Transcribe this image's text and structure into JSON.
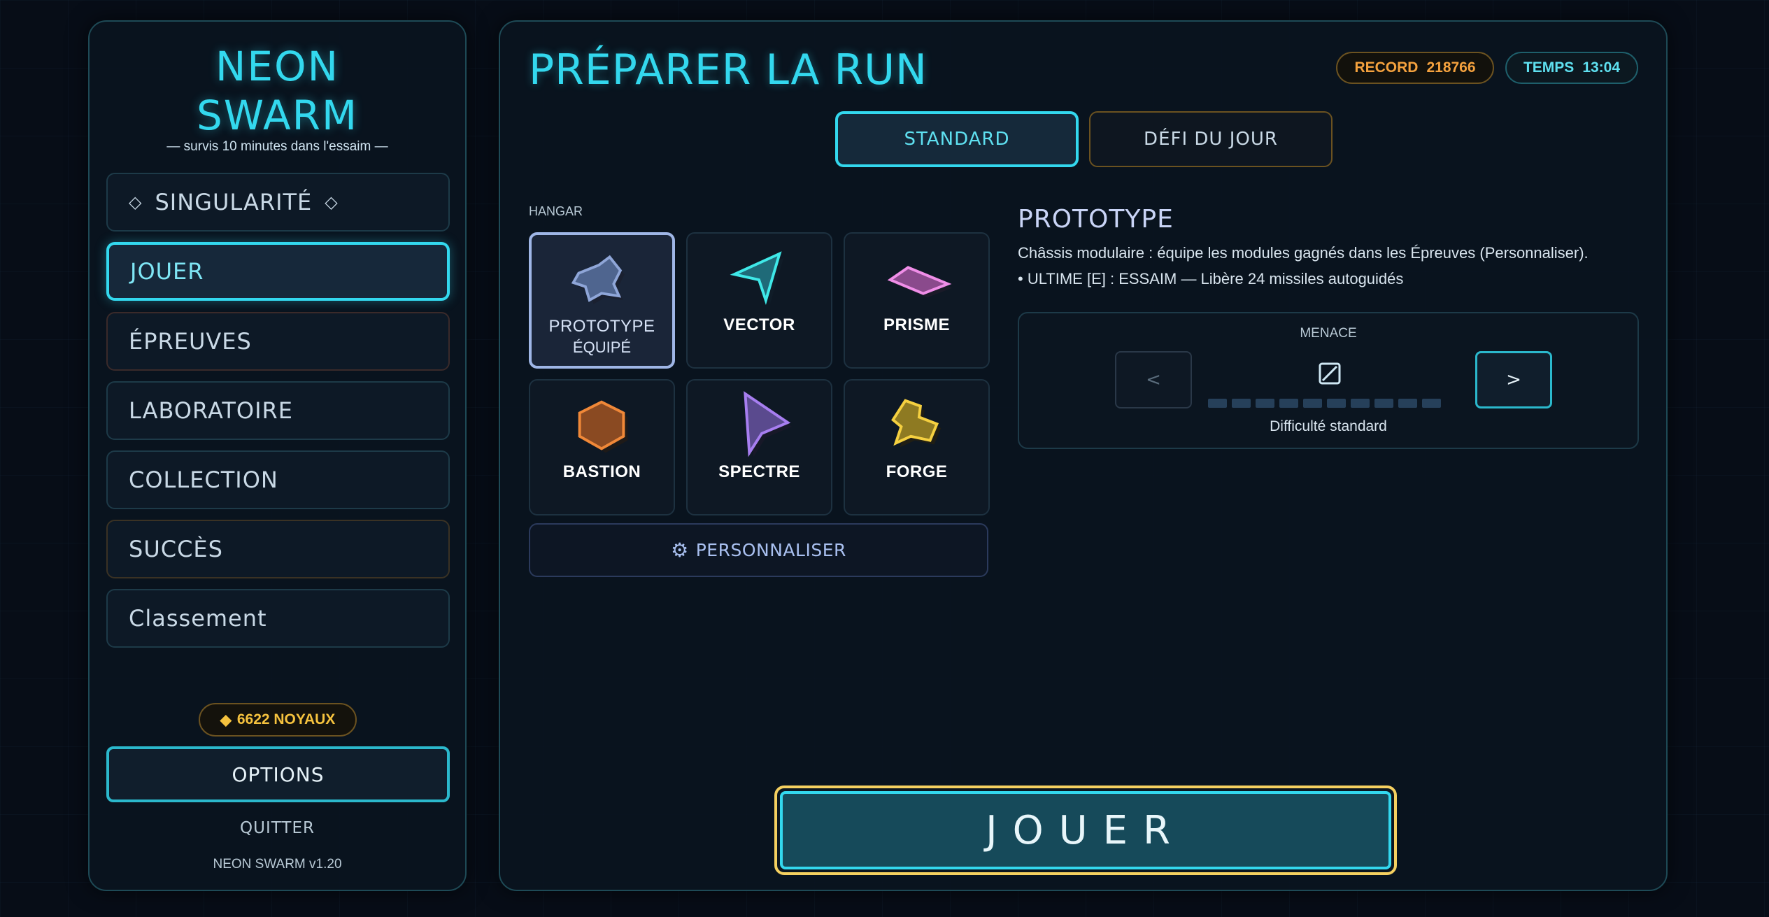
{
  "sidebar": {
    "logo_line1": "NEON",
    "logo_line2": "SWARM",
    "tagline": "— survis 10 minutes dans l'essaim —",
    "items": [
      {
        "label": "SINGULARITÉ"
      },
      {
        "label": "JOUER"
      },
      {
        "label": "ÉPREUVES"
      },
      {
        "label": "LABORATOIRE"
      },
      {
        "label": "COLLECTION"
      },
      {
        "label": "SUCCÈS"
      },
      {
        "label": "Classement"
      }
    ],
    "diamond": "◇",
    "noyaux_icon": "◆",
    "noyaux": "6622 NOYAUX",
    "options": "OPTIONS",
    "quit": "QUITTER",
    "version": "NEON SWARM v1.20"
  },
  "main": {
    "title": "PRÉPARER LA RUN",
    "record_label": "RECORD",
    "record_value": "218766",
    "time_label": "TEMPS",
    "time_value": "13:04",
    "modes": [
      {
        "label": "STANDARD",
        "selected": true
      },
      {
        "label": "DÉFI DU JOUR",
        "selected": false
      }
    ],
    "hangar_label": "HANGAR",
    "ships": [
      {
        "name": "PROTOTYPE",
        "sub": "ÉQUIPÉ",
        "icon": "prototype-ship-icon",
        "color": "#7f9bd6",
        "selected": true
      },
      {
        "name": "VECTOR",
        "icon": "vector-ship-icon",
        "color": "#3fe8e8"
      },
      {
        "name": "PRISME",
        "icon": "prisme-ship-icon",
        "color": "#e27ee0"
      },
      {
        "name": "BASTION",
        "icon": "bastion-ship-icon",
        "color": "#f08838"
      },
      {
        "name": "SPECTRE",
        "icon": "spectre-ship-icon",
        "color": "#a77ef0"
      },
      {
        "name": "FORGE",
        "icon": "forge-ship-icon",
        "color": "#f5d040"
      }
    ],
    "customize_icon": "⚙",
    "customize": "PERSONNALISER",
    "detail": {
      "title": "PROTOTYPE",
      "description": "Châssis modulaire : équipe les modules gagnés dans les Épreuves (Personnaliser).",
      "bullet": "•  ULTIME [E] : ESSAIM — Libère 24 missiles autoguidés"
    },
    "menace": {
      "label": "MENACE",
      "prev": "<",
      "next": ">",
      "level": 0,
      "max": 10,
      "status": "Difficulté standard"
    },
    "play": "JOUER"
  },
  "colors": {
    "accent": "#33d8ee",
    "gold": "#f5c23e",
    "panel": "#0a1420"
  }
}
